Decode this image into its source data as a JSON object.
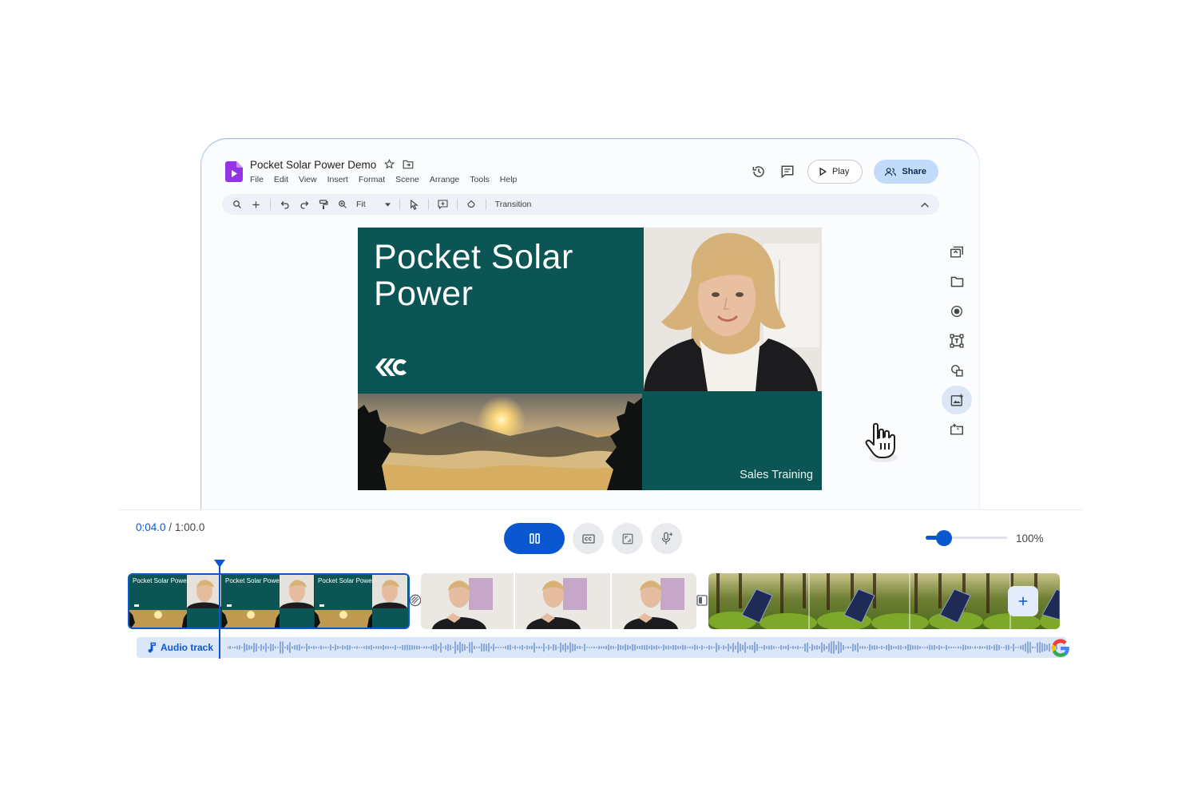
{
  "document": {
    "title": "Pocket Solar Power Demo"
  },
  "menu": [
    "File",
    "Edit",
    "View",
    "Insert",
    "Format",
    "Scene",
    "Arrange",
    "Tools",
    "Help"
  ],
  "header_actions": {
    "play_label": "Play",
    "share_label": "Share"
  },
  "toolbar": {
    "zoom_value": "Fit",
    "transition_label": "Transition"
  },
  "slide": {
    "title_line1": "Pocket Solar",
    "title_line2": "Power",
    "subtitle": "Sales Training"
  },
  "timeline": {
    "current_time": "0:04.0",
    "separator": " / ",
    "total_time": "1:00.0",
    "zoom_percent": 100,
    "zoom_label": "100%",
    "zoom_slider_fraction": 0.23,
    "scene1_frame_text": [
      "Pocket Solar Power",
      "Pocket Solar Power",
      "Pocket Solar Power"
    ],
    "audio_label": "Audio track"
  },
  "colors": {
    "accent": "#0b57d0",
    "slide_teal": "#0b5654",
    "share_bg": "#c2dbfb"
  },
  "icons": {
    "side_panel": [
      "screen-record-icon",
      "folder-icon",
      "record-icon",
      "text-box-icon",
      "shapes-icon",
      "media-icon",
      "scene-transition-icon"
    ],
    "transport": [
      "pause-icon",
      "captions-icon",
      "fullscreen-icon",
      "voiceover-icon"
    ]
  }
}
